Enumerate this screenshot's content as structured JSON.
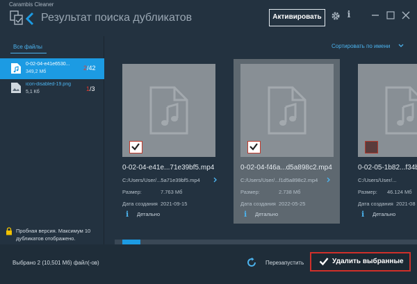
{
  "app": {
    "name": "Carambis Cleaner",
    "title": "Результат поиска дубликатов",
    "activate_label": "Активировать"
  },
  "sidebar": {
    "filter_label": "Все файлы",
    "items": [
      {
        "name": "0-02-04-e41e6530...",
        "size": "349,2 Мб",
        "count_selected": "2",
        "count_total": "/42",
        "selected": true
      },
      {
        "name": "icon-disabled-19.png",
        "size": "5,1 Кб",
        "count_selected": "1",
        "count_total": "/3",
        "selected": false
      }
    ],
    "trial_notice": "Пробная версия. Максимум 10 дубликатов отображено."
  },
  "main": {
    "sort_label": "Сортировать по имени",
    "cards": [
      {
        "name": "0-02-04-e41e...71e39bf5.mp4",
        "path": "C:/Users/User/...5a71e39bf5.mp4",
        "size_label": "Размер:",
        "size": "7.763 Мб",
        "date_label": "Дата создания",
        "date": "2021-09-15",
        "details": "Детально",
        "checked": true
      },
      {
        "name": "0-02-04-f46a...d5a898c2.mp4",
        "path": "C:/Users/User/...f1d5a898c2.mp4",
        "size_label": "Размер:",
        "size": "2.738 Мб",
        "date_label": "Дата создания",
        "date": "2022-05-25",
        "details": "Детально",
        "checked": true
      },
      {
        "name": "0-02-05-1b82...f34b",
        "path": "C:/Users/User/...",
        "size_label": "Размер:",
        "size": "46.124 Мб",
        "date_label": "Дата создания",
        "date": "2021-08",
        "details": "Детально",
        "checked": false
      }
    ]
  },
  "footer": {
    "selected_status": "Выбрано 2 (10,501 Мб) файл(-ов)",
    "restart_label": "Перезапустить",
    "delete_label": "Удалить выбранные"
  },
  "colors": {
    "background": "#233240",
    "accent": "#1c9be3",
    "danger": "#d0302a"
  }
}
